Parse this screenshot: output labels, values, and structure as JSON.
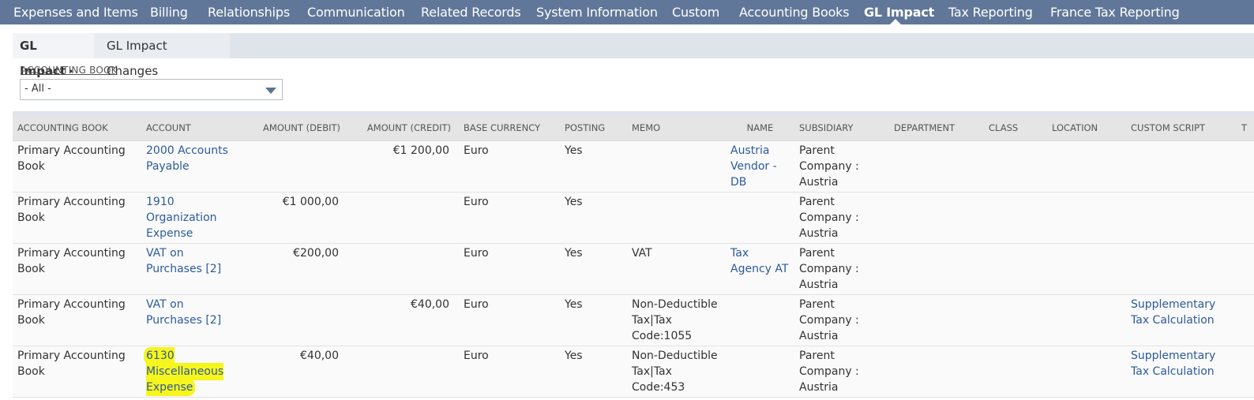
{
  "nav": {
    "items": [
      {
        "label": "Expenses and Items",
        "active": false
      },
      {
        "label": "Billing",
        "active": false
      },
      {
        "label": "Relationships",
        "active": false
      },
      {
        "label": "Communication",
        "active": false
      },
      {
        "label": "Related Records",
        "active": false
      },
      {
        "label": "System Information",
        "active": false
      },
      {
        "label": "Custom",
        "active": false
      },
      {
        "label": "Accounting Books",
        "active": false
      },
      {
        "label": "GL Impact",
        "active": true
      },
      {
        "label": "Tax Reporting",
        "active": false
      },
      {
        "label": "France Tax Reporting",
        "active": false
      }
    ]
  },
  "subtabs": {
    "active_label": "GL Impact",
    "active_marker": "•",
    "second_label": "GL Impact Changes"
  },
  "filter": {
    "label": "ACCOUNTING BOOK",
    "value": "- All -"
  },
  "table": {
    "headers": [
      "ACCOUNTING BOOK",
      "ACCOUNT",
      "AMOUNT (DEBIT)",
      "AMOUNT (CREDIT)",
      "BASE CURRENCY",
      "POSTING",
      "MEMO",
      "NAME",
      "SUBSIDIARY",
      "DEPARTMENT",
      "CLASS",
      "LOCATION",
      "CUSTOM SCRIPT",
      "T"
    ],
    "rows": [
      {
        "book": "Primary Accounting Book",
        "account": "2000 Accounts Payable",
        "debit": "",
        "credit": "€1 200,00",
        "currency": "Euro",
        "posting": "Yes",
        "memo": "",
        "name": "Austria Vendor - DB",
        "subsidiary": "Parent Company : Austria",
        "department": "",
        "class": "",
        "location": "",
        "custom_script": ""
      },
      {
        "book": "Primary Accounting Book",
        "account": "1910 Organization Expense",
        "debit": "€1 000,00",
        "credit": "",
        "currency": "Euro",
        "posting": "Yes",
        "memo": "",
        "name": "",
        "subsidiary": "Parent Company : Austria",
        "department": "",
        "class": "",
        "location": "",
        "custom_script": ""
      },
      {
        "book": "Primary Accounting Book",
        "account": "VAT on Purchases [2]",
        "debit": "€200,00",
        "credit": "",
        "currency": "Euro",
        "posting": "Yes",
        "memo": "VAT",
        "name": "Tax Agency AT",
        "subsidiary": "Parent Company : Austria",
        "department": "",
        "class": "",
        "location": "",
        "custom_script": ""
      },
      {
        "book": "Primary Accounting Book",
        "account": "VAT on Purchases [2]",
        "debit": "",
        "credit": "€40,00",
        "currency": "Euro",
        "posting": "Yes",
        "memo": "Non-Deductible Tax|Tax Code:1055",
        "name": "",
        "subsidiary": "Parent Company : Austria",
        "department": "",
        "class": "",
        "location": "",
        "custom_script": "Supplementary Tax Calculation"
      },
      {
        "book": "Primary Accounting Book",
        "account": "6130 Miscellaneous Expense",
        "debit": "€40,00",
        "credit": "",
        "currency": "Euro",
        "posting": "Yes",
        "memo": "Non-Deductible Tax|Tax Code:453",
        "name": "",
        "subsidiary": "Parent Company : Austria",
        "department": "",
        "class": "",
        "location": "",
        "custom_script": "Supplementary Tax Calculation",
        "highlighted": true
      }
    ]
  },
  "colors": {
    "nav_bg": "#607799",
    "link": "#2d5a9b",
    "highlight": "#f6f51c"
  }
}
